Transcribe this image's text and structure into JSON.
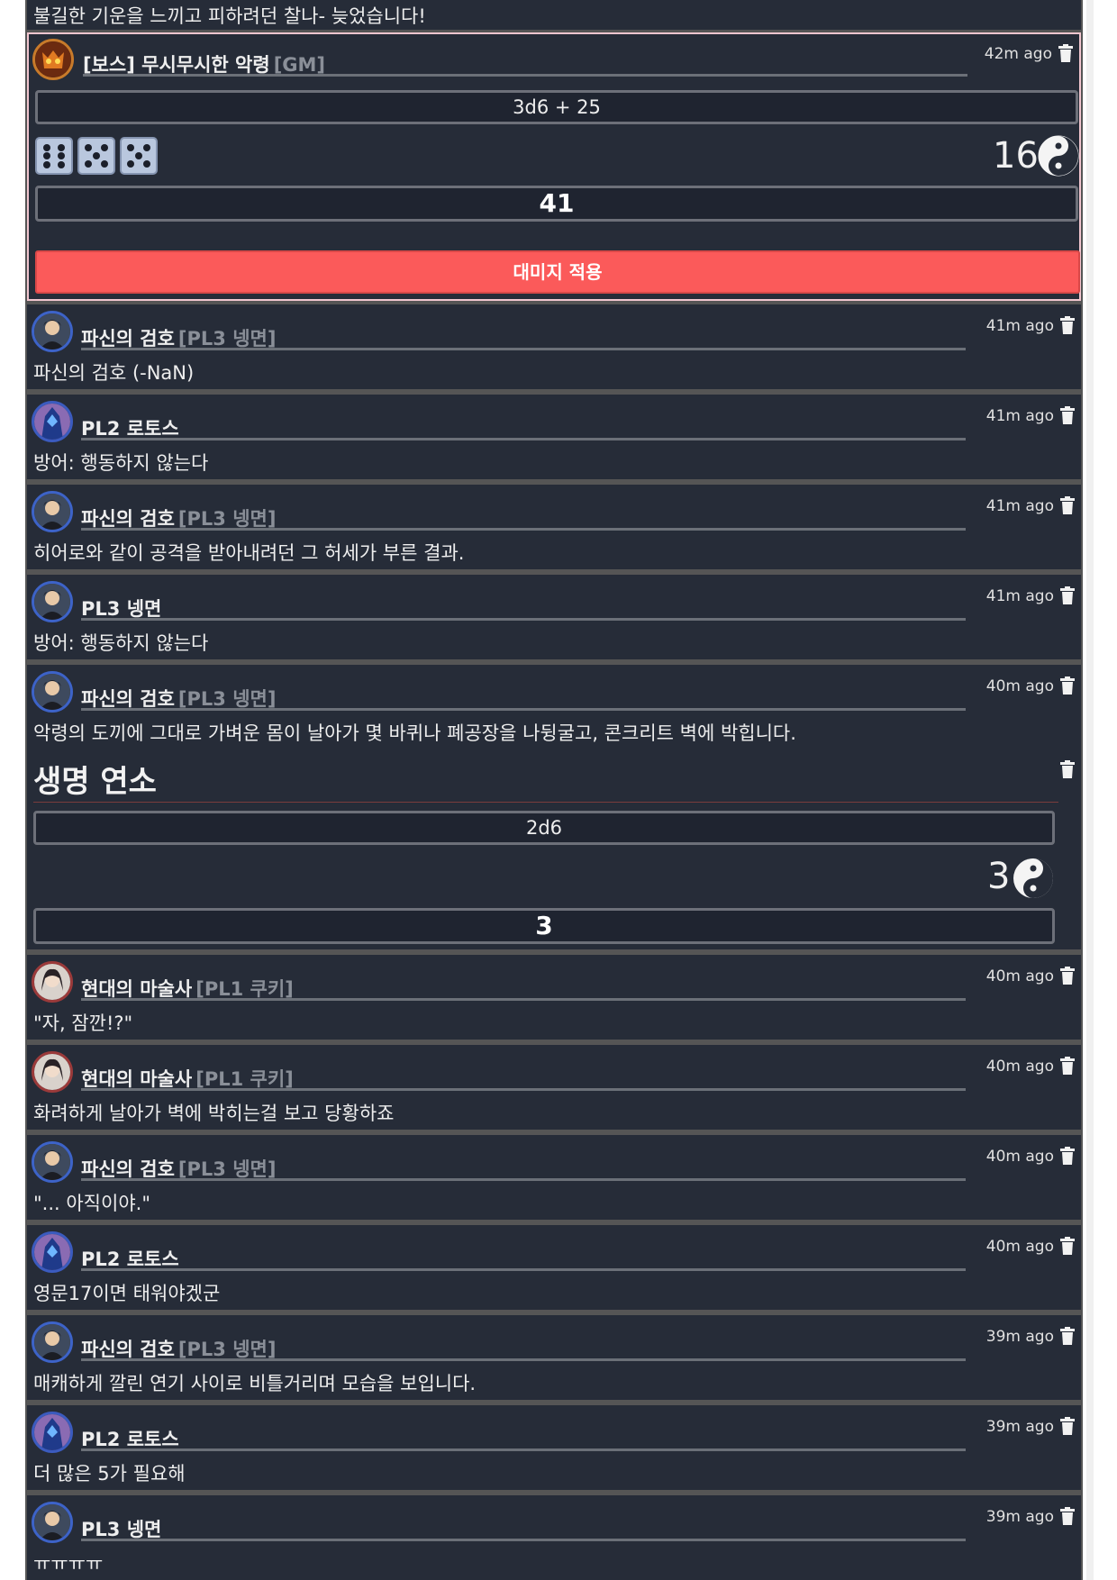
{
  "log": {
    "top_partial": {
      "text": "불길한 기운을 느끼고 피하려던 찰나- 늦었습니다!"
    },
    "boss_roll": {
      "sender": "[보스] 무시무시한 악령",
      "tag": "[GM]",
      "time": "42m ago",
      "formula": "3d6 + 25",
      "dice": [
        6,
        5,
        5
      ],
      "roll_sum": "16",
      "total": "41",
      "apply_button": "대미지 적용"
    },
    "messages": [
      {
        "sender": "파신의 검호",
        "tag": "[PL3 넹면]",
        "time": "41m ago",
        "text": "파신의 검호 (-NaN)",
        "avatar": "swordsman"
      },
      {
        "sender": "PL2 로토스",
        "tag": "",
        "time": "41m ago",
        "text": "방어: 행동하지 않는다",
        "avatar": "knight"
      },
      {
        "sender": "파신의 검호",
        "tag": "[PL3 넹면]",
        "time": "41m ago",
        "text": "히어로와 같이 공격을 받아내려던 그 허세가 부른 결과.",
        "avatar": "swordsman"
      },
      {
        "sender": "PL3 넹면",
        "tag": "",
        "time": "41m ago",
        "text": "방어: 행동하지 않는다",
        "avatar": "swordsman"
      },
      {
        "sender": "파신의 검호",
        "tag": "[PL3 넹면]",
        "time": "40m ago",
        "text": "악령의 도끼에 그대로 가벼운 몸이 날아가 몇 바퀴나 폐공장을 나뒹굴고, 콘크리트 벽에 박힙니다.",
        "avatar": "swordsman"
      }
    ],
    "life_roll": {
      "title": "생명 연소",
      "formula": "2d6",
      "roll_sum": "3",
      "total": "3"
    },
    "messages2": [
      {
        "sender": "현대의 마술사",
        "tag": "[PL1 쿠키]",
        "time": "40m ago",
        "text": "\"자, 잠깐!?\"",
        "avatar": "mage"
      },
      {
        "sender": "현대의 마술사",
        "tag": "[PL1 쿠키]",
        "time": "40m ago",
        "text": "화려하게 날아가 벽에 박히는걸 보고 당황하죠",
        "avatar": "mage"
      },
      {
        "sender": "파신의 검호",
        "tag": "[PL3 넹면]",
        "time": "40m ago",
        "text": "\"... 아직이야.\"",
        "avatar": "swordsman"
      },
      {
        "sender": "PL2 로토스",
        "tag": "",
        "time": "40m ago",
        "text": "영문17이면 태워야겠군",
        "avatar": "knight"
      },
      {
        "sender": "파신의 검호",
        "tag": "[PL3 넹면]",
        "time": "39m ago",
        "text": "매캐하게 깔린 연기 사이로 비틀거리며 모습을 보입니다.",
        "avatar": "swordsman"
      },
      {
        "sender": "PL2 로토스",
        "tag": "",
        "time": "39m ago",
        "text": "더 많은 5가 필요해",
        "avatar": "knight"
      },
      {
        "sender": "PL3 넹면",
        "tag": "",
        "time": "39m ago",
        "text": "ㅠㅠㅠㅠ",
        "avatar": "swordsman"
      }
    ]
  },
  "colors": {
    "panel": "#262c38",
    "accent_button": "#fb5a5a",
    "boss_border": "#f1c6cf"
  },
  "icons": {
    "delete": "trash-icon",
    "dice_result": "yin-yang-icon"
  }
}
